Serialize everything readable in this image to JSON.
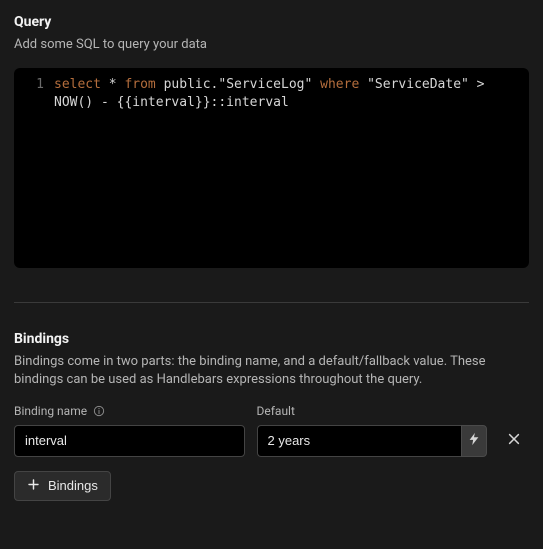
{
  "query": {
    "title": "Query",
    "description": "Add some SQL to query your data",
    "line_number": "1",
    "code_tokens": [
      {
        "t": "select ",
        "kw": true
      },
      {
        "t": "* ",
        "kw": false
      },
      {
        "t": "from ",
        "kw": true
      },
      {
        "t": "public.\"ServiceLog\" ",
        "kw": false
      },
      {
        "t": "where ",
        "kw": true
      },
      {
        "t": "\"ServiceDate\" > NOW() - {{interval}}::interval",
        "kw": false
      }
    ]
  },
  "bindings": {
    "title": "Bindings",
    "description": "Bindings come in two parts: the binding name, and a default/fallback value. These bindings can be used as Handlebars expressions throughout the query.",
    "name_label": "Binding name",
    "default_label": "Default",
    "rows": [
      {
        "name": "interval",
        "default": "2 years"
      }
    ],
    "add_button_label": "Bindings"
  }
}
